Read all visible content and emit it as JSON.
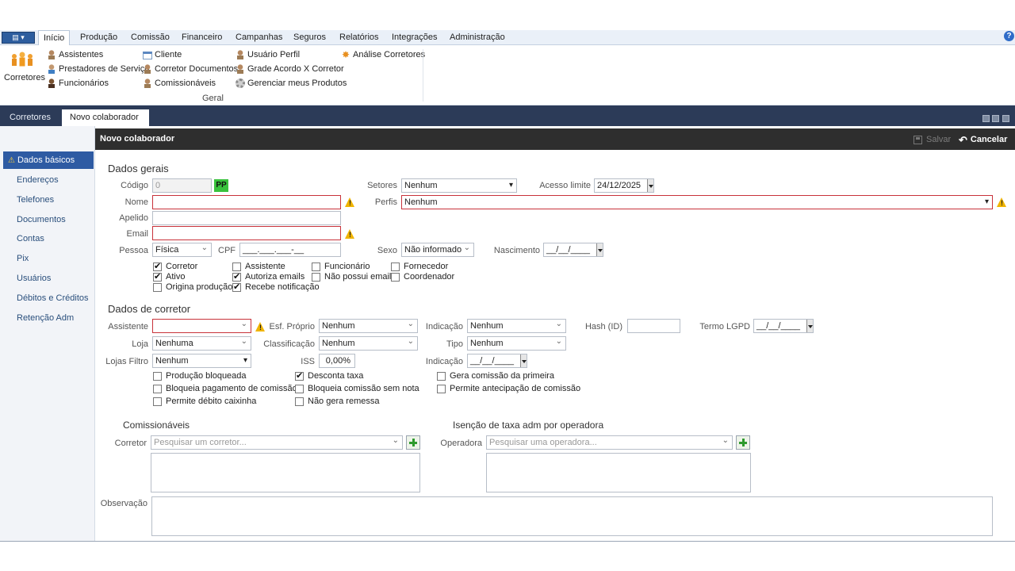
{
  "menu": {
    "app_button": "▤ ▾",
    "tabs": [
      "Início",
      "Produção",
      "Comissão",
      "Financeiro",
      "Campanhas",
      "Seguros",
      "Relatórios",
      "Integrações",
      "Administração"
    ],
    "help": "?"
  },
  "ribbon": {
    "big": "Corretores",
    "col1": [
      "Assistentes",
      "Prestadores de Serviço",
      "Funcionários"
    ],
    "col2": [
      "Cliente",
      "Corretor Documentos",
      "Comissionáveis"
    ],
    "col3": [
      "Usuário Perfil",
      "Grade Acordo X Corretor",
      "Gerenciar meus Produtos"
    ],
    "col4": [
      "Análise Corretores"
    ],
    "group_label": "Geral"
  },
  "doc_tabs": [
    "Corretores",
    "Novo colaborador"
  ],
  "nav": [
    "Dados básicos",
    "Endereços",
    "Telefones",
    "Documentos",
    "Contas",
    "Pix",
    "Usuários",
    "Débitos e Créditos",
    "Retenção Adm"
  ],
  "panel": {
    "title": "Novo colaborador",
    "save": "Salvar",
    "cancel": "Cancelar"
  },
  "dados_gerais": {
    "title": "Dados gerais",
    "codigo_label": "Código",
    "codigo_value": "0",
    "pp_badge": "PP",
    "setores_label": "Setores",
    "setores_value": "Nenhum",
    "acesso_label": "Acesso limite",
    "acesso_value": "24/12/2025",
    "nome_label": "Nome",
    "nome_value": "",
    "perfis_label": "Perfis",
    "perfis_value": "Nenhum",
    "apelido_label": "Apelido",
    "apelido_value": "",
    "email_label": "Email",
    "email_value": "",
    "pessoa_label": "Pessoa",
    "pessoa_value": "Física",
    "cpf_label": "CPF",
    "cpf_value": "___.___.___-__",
    "sexo_label": "Sexo",
    "sexo_value": "Não informado",
    "nascimento_label": "Nascimento",
    "nascimento_value": "__/__/____",
    "checks": [
      {
        "label": "Corretor",
        "checked": true
      },
      {
        "label": "Ativo",
        "checked": true
      },
      {
        "label": "Origina produção",
        "checked": false
      },
      {
        "label": "Assistente",
        "checked": false
      },
      {
        "label": "Autoriza emails",
        "checked": true
      },
      {
        "label": "Recebe notificação",
        "checked": true
      },
      {
        "label": "Funcionário",
        "checked": false
      },
      {
        "label": "Não possui email",
        "checked": false
      },
      {
        "label": "Fornecedor",
        "checked": false
      },
      {
        "label": "Coordenador",
        "checked": false
      }
    ]
  },
  "dados_corretor": {
    "title": "Dados de corretor",
    "assistente_label": "Assistente",
    "assistente_value": "",
    "esf_label": "Esf. Próprio",
    "esf_value": "Nenhum",
    "indicacao_label": "Indicação",
    "indicacao_value": "Nenhum",
    "hash_label": "Hash (ID)",
    "hash_value": "",
    "termo_label": "Termo LGPD",
    "termo_value": "__/__/____",
    "loja_label": "Loja",
    "loja_value": "Nenhuma",
    "classificacao_label": "Classificação",
    "classificacao_value": "Nenhum",
    "tipo_label": "Tipo",
    "tipo_value": "Nenhum",
    "lojas_filtro_label": "Lojas Filtro",
    "lojas_filtro_value": "Nenhum",
    "iss_label": "ISS",
    "iss_value": "0,00%",
    "indicacao2_label": "Indicação",
    "indicacao2_value": "__/__/____",
    "checks": [
      {
        "label": "Produção bloqueada",
        "checked": false
      },
      {
        "label": "Bloqueia pagamento de comissão",
        "checked": false
      },
      {
        "label": "Permite débito caixinha",
        "checked": false
      },
      {
        "label": "Desconta taxa",
        "checked": true
      },
      {
        "label": "Bloqueia comissão sem nota",
        "checked": false
      },
      {
        "label": "Não gera remessa",
        "checked": false
      },
      {
        "label": "Gera comissão da primeira",
        "checked": false
      },
      {
        "label": "Permite antecipação de comissão",
        "checked": false
      }
    ]
  },
  "comissionaveis": {
    "title": "Comissionáveis",
    "label": "Corretor",
    "placeholder": "Pesquisar um corretor..."
  },
  "isencao": {
    "title": "Isenção de taxa adm por operadora",
    "label": "Operadora",
    "placeholder": "Pesquisar uma operadora..."
  },
  "observacao_label": "Observação"
}
